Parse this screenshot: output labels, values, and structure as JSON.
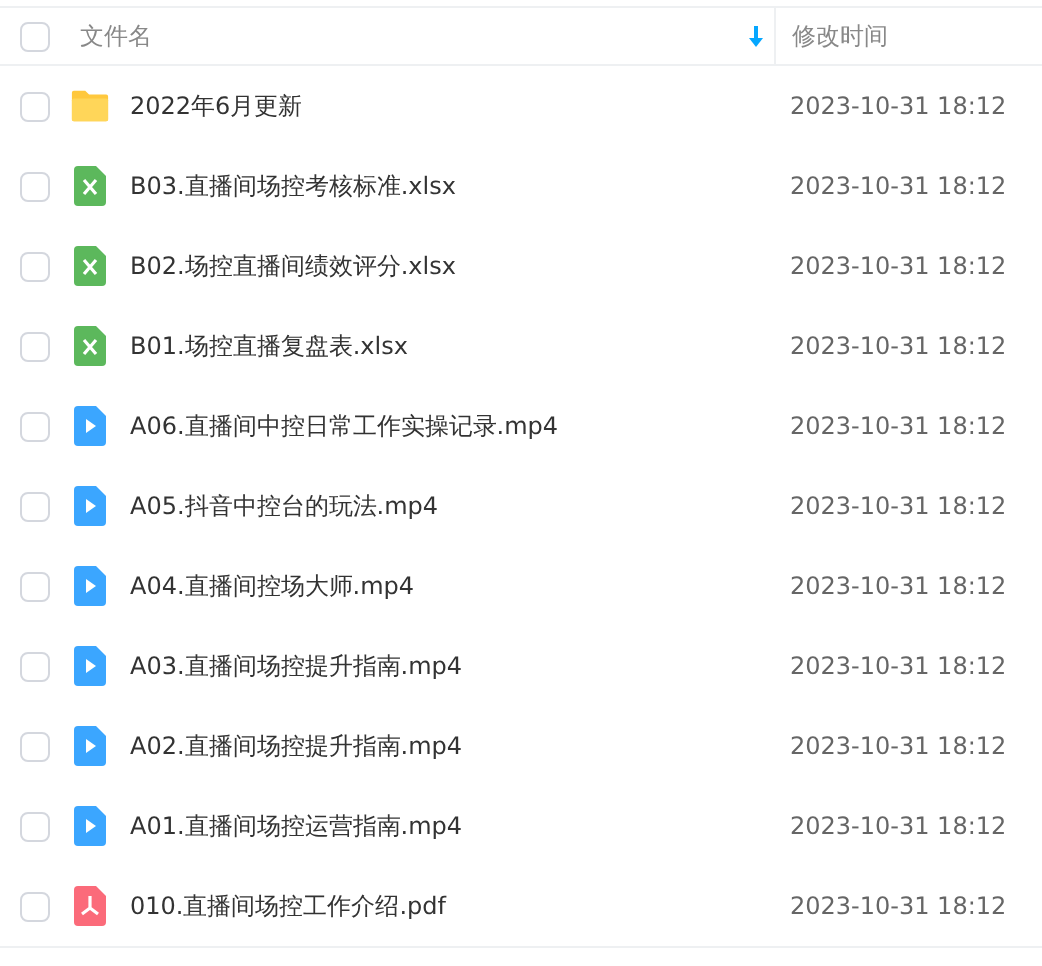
{
  "header": {
    "checked": false,
    "columns": [
      "文件名",
      "修改时间"
    ]
  },
  "rows": [
    {
      "kind": "folder",
      "name": "2022年6月更新",
      "modified": "2023-10-31 18:12",
      "checked": false
    },
    {
      "kind": "excel",
      "name": "B03.直播间场控考核标准.xlsx",
      "modified": "2023-10-31 18:12",
      "checked": false
    },
    {
      "kind": "excel",
      "name": "B02.场控直播间绩效评分.xlsx",
      "modified": "2023-10-31 18:12",
      "checked": false
    },
    {
      "kind": "excel",
      "name": "B01.场控直播复盘表.xlsx",
      "modified": "2023-10-31 18:12",
      "checked": false
    },
    {
      "kind": "video",
      "name": "A06.直播间中控日常工作实操记录.mp4",
      "modified": "2023-10-31 18:12",
      "checked": false
    },
    {
      "kind": "video",
      "name": "A05.抖音中控台的玩法.mp4",
      "modified": "2023-10-31 18:12",
      "checked": false
    },
    {
      "kind": "video",
      "name": "A04.直播间控场大师.mp4",
      "modified": "2023-10-31 18:12",
      "checked": false
    },
    {
      "kind": "video",
      "name": "A03.直播间场控提升指南.mp4",
      "modified": "2023-10-31 18:12",
      "checked": false
    },
    {
      "kind": "video",
      "name": "A02.直播间场控提升指南.mp4",
      "modified": "2023-10-31 18:12",
      "checked": false
    },
    {
      "kind": "video",
      "name": "A01.直播间场控运营指南.mp4",
      "modified": "2023-10-31 18:12",
      "checked": false
    },
    {
      "kind": "pdf",
      "name": "010.直播间场控工作介绍.pdf",
      "modified": "2023-10-31 18:12",
      "checked": false
    }
  ]
}
